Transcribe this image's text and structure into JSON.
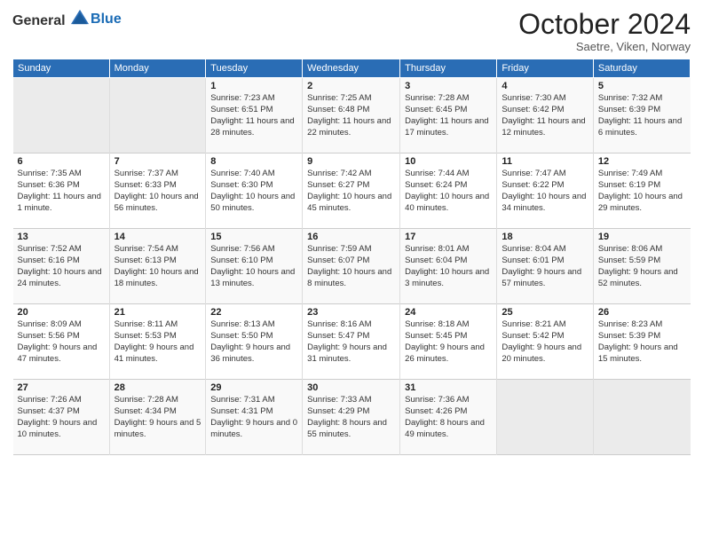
{
  "header": {
    "logo_general": "General",
    "logo_blue": "Blue",
    "month_title": "October 2024",
    "location": "Saetre, Viken, Norway"
  },
  "days_of_week": [
    "Sunday",
    "Monday",
    "Tuesday",
    "Wednesday",
    "Thursday",
    "Friday",
    "Saturday"
  ],
  "weeks": [
    [
      {
        "num": "",
        "info": ""
      },
      {
        "num": "",
        "info": ""
      },
      {
        "num": "1",
        "info": "Sunrise: 7:23 AM\nSunset: 6:51 PM\nDaylight: 11 hours\nand 28 minutes."
      },
      {
        "num": "2",
        "info": "Sunrise: 7:25 AM\nSunset: 6:48 PM\nDaylight: 11 hours\nand 22 minutes."
      },
      {
        "num": "3",
        "info": "Sunrise: 7:28 AM\nSunset: 6:45 PM\nDaylight: 11 hours\nand 17 minutes."
      },
      {
        "num": "4",
        "info": "Sunrise: 7:30 AM\nSunset: 6:42 PM\nDaylight: 11 hours\nand 12 minutes."
      },
      {
        "num": "5",
        "info": "Sunrise: 7:32 AM\nSunset: 6:39 PM\nDaylight: 11 hours\nand 6 minutes."
      }
    ],
    [
      {
        "num": "6",
        "info": "Sunrise: 7:35 AM\nSunset: 6:36 PM\nDaylight: 11 hours\nand 1 minute."
      },
      {
        "num": "7",
        "info": "Sunrise: 7:37 AM\nSunset: 6:33 PM\nDaylight: 10 hours\nand 56 minutes."
      },
      {
        "num": "8",
        "info": "Sunrise: 7:40 AM\nSunset: 6:30 PM\nDaylight: 10 hours\nand 50 minutes."
      },
      {
        "num": "9",
        "info": "Sunrise: 7:42 AM\nSunset: 6:27 PM\nDaylight: 10 hours\nand 45 minutes."
      },
      {
        "num": "10",
        "info": "Sunrise: 7:44 AM\nSunset: 6:24 PM\nDaylight: 10 hours\nand 40 minutes."
      },
      {
        "num": "11",
        "info": "Sunrise: 7:47 AM\nSunset: 6:22 PM\nDaylight: 10 hours\nand 34 minutes."
      },
      {
        "num": "12",
        "info": "Sunrise: 7:49 AM\nSunset: 6:19 PM\nDaylight: 10 hours\nand 29 minutes."
      }
    ],
    [
      {
        "num": "13",
        "info": "Sunrise: 7:52 AM\nSunset: 6:16 PM\nDaylight: 10 hours\nand 24 minutes."
      },
      {
        "num": "14",
        "info": "Sunrise: 7:54 AM\nSunset: 6:13 PM\nDaylight: 10 hours\nand 18 minutes."
      },
      {
        "num": "15",
        "info": "Sunrise: 7:56 AM\nSunset: 6:10 PM\nDaylight: 10 hours\nand 13 minutes."
      },
      {
        "num": "16",
        "info": "Sunrise: 7:59 AM\nSunset: 6:07 PM\nDaylight: 10 hours\nand 8 minutes."
      },
      {
        "num": "17",
        "info": "Sunrise: 8:01 AM\nSunset: 6:04 PM\nDaylight: 10 hours\nand 3 minutes."
      },
      {
        "num": "18",
        "info": "Sunrise: 8:04 AM\nSunset: 6:01 PM\nDaylight: 9 hours\nand 57 minutes."
      },
      {
        "num": "19",
        "info": "Sunrise: 8:06 AM\nSunset: 5:59 PM\nDaylight: 9 hours\nand 52 minutes."
      }
    ],
    [
      {
        "num": "20",
        "info": "Sunrise: 8:09 AM\nSunset: 5:56 PM\nDaylight: 9 hours\nand 47 minutes."
      },
      {
        "num": "21",
        "info": "Sunrise: 8:11 AM\nSunset: 5:53 PM\nDaylight: 9 hours\nand 41 minutes."
      },
      {
        "num": "22",
        "info": "Sunrise: 8:13 AM\nSunset: 5:50 PM\nDaylight: 9 hours\nand 36 minutes."
      },
      {
        "num": "23",
        "info": "Sunrise: 8:16 AM\nSunset: 5:47 PM\nDaylight: 9 hours\nand 31 minutes."
      },
      {
        "num": "24",
        "info": "Sunrise: 8:18 AM\nSunset: 5:45 PM\nDaylight: 9 hours\nand 26 minutes."
      },
      {
        "num": "25",
        "info": "Sunrise: 8:21 AM\nSunset: 5:42 PM\nDaylight: 9 hours\nand 20 minutes."
      },
      {
        "num": "26",
        "info": "Sunrise: 8:23 AM\nSunset: 5:39 PM\nDaylight: 9 hours\nand 15 minutes."
      }
    ],
    [
      {
        "num": "27",
        "info": "Sunrise: 7:26 AM\nSunset: 4:37 PM\nDaylight: 9 hours\nand 10 minutes."
      },
      {
        "num": "28",
        "info": "Sunrise: 7:28 AM\nSunset: 4:34 PM\nDaylight: 9 hours\nand 5 minutes."
      },
      {
        "num": "29",
        "info": "Sunrise: 7:31 AM\nSunset: 4:31 PM\nDaylight: 9 hours\nand 0 minutes."
      },
      {
        "num": "30",
        "info": "Sunrise: 7:33 AM\nSunset: 4:29 PM\nDaylight: 8 hours\nand 55 minutes."
      },
      {
        "num": "31",
        "info": "Sunrise: 7:36 AM\nSunset: 4:26 PM\nDaylight: 8 hours\nand 49 minutes."
      },
      {
        "num": "",
        "info": ""
      },
      {
        "num": "",
        "info": ""
      }
    ]
  ]
}
